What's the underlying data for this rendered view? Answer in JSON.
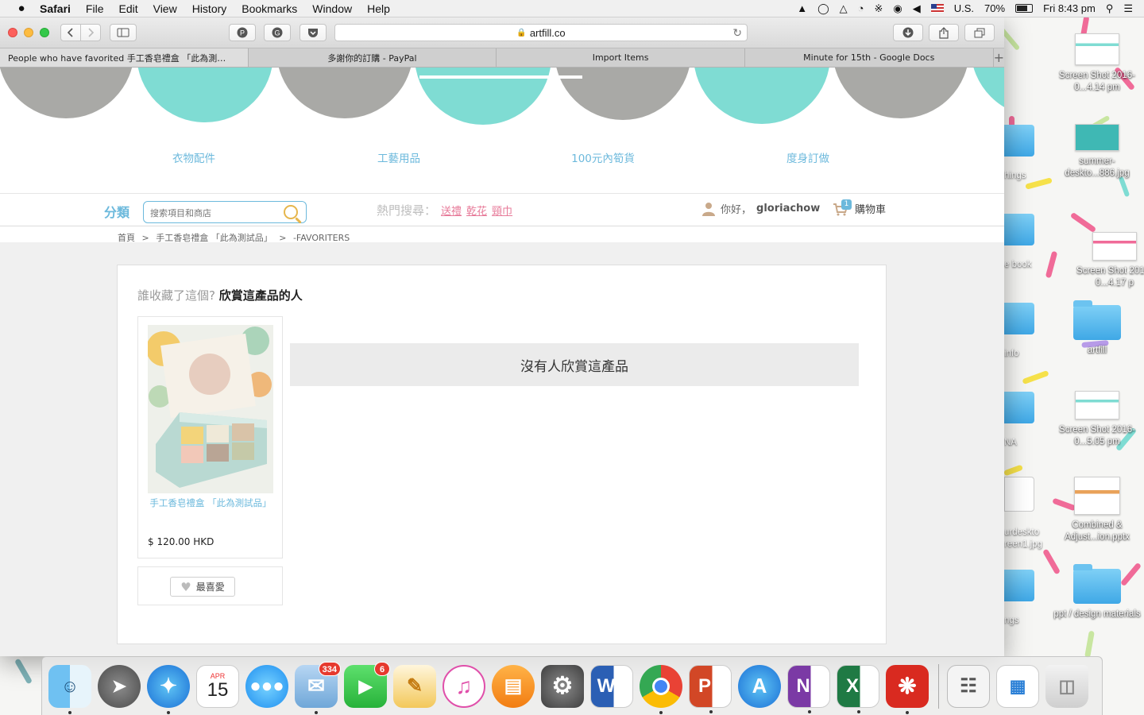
{
  "menubar": {
    "app_name": "Safari",
    "menus": [
      "File",
      "Edit",
      "View",
      "History",
      "Bookmarks",
      "Window",
      "Help"
    ],
    "input_source": "U.S.",
    "battery_percent": "70%",
    "battery_level": 0.7,
    "clock": "Fri 8:43 pm"
  },
  "browser": {
    "url": "artfill.co",
    "tabs": [
      {
        "label": "People who have favorited 手工香皂禮盒 「此為測…",
        "active": true
      },
      {
        "label": "多謝你的訂購 - PayPal",
        "active": false
      },
      {
        "label": "Import Items",
        "active": false
      },
      {
        "label": "Minute for 15th - Google Docs",
        "active": false
      }
    ]
  },
  "site": {
    "colors": {
      "teal": "#7fdcd3",
      "gray": "#a9a9a6",
      "link": "#6cb9dc",
      "pink": "#e77a99"
    },
    "categories": [
      "衣物配件",
      "工藝用品",
      "100元內筍貨",
      "度身訂做"
    ],
    "subbar": {
      "category_label": "分類",
      "search_placeholder": "搜索項目和商店",
      "hot_label": "熱門搜尋：",
      "hot_keywords": [
        "送禮",
        "乾花",
        "頸巾"
      ],
      "greeting": "你好，",
      "username": "gloriachow",
      "cart_label": "購物車",
      "cart_count": "1"
    },
    "breadcrumb": [
      "首頁",
      ">",
      "手工香皂禮盒 「此為測試品」",
      ">",
      "-FAVORITERS"
    ],
    "favoriters": {
      "heading_prefix": "誰收藏了這個?",
      "heading_main": "欣賞這產品的人",
      "product_name": "手工香皂禮盒 「此為測試品」",
      "product_price": "$ 120.00 HKD",
      "fav_button": "最喜愛",
      "empty_message": "沒有人欣賞這產品"
    }
  },
  "desktop": {
    "icons": [
      {
        "label": "Screen Shot 2016-0...4.14 pm"
      },
      {
        "label": "summer-deskto...886.jpg"
      },
      {
        "label": "Screen Shot 2016-0...4.17 p"
      },
      {
        "label": "artfill"
      },
      {
        "label": "Screen Shot 2016-0...5.05 pm"
      },
      {
        "label": "Combined & Adjust...ion.pptx"
      },
      {
        "label": "ppt / design materials"
      }
    ],
    "partial_labels": [
      "hings",
      "e book",
      "info",
      "NA",
      "urdeskto reen1.jpg",
      "ngs"
    ]
  },
  "dock": {
    "badges": {
      "mail": "334",
      "facetime": "6"
    },
    "calendar": {
      "month": "APR",
      "day": "15"
    }
  }
}
